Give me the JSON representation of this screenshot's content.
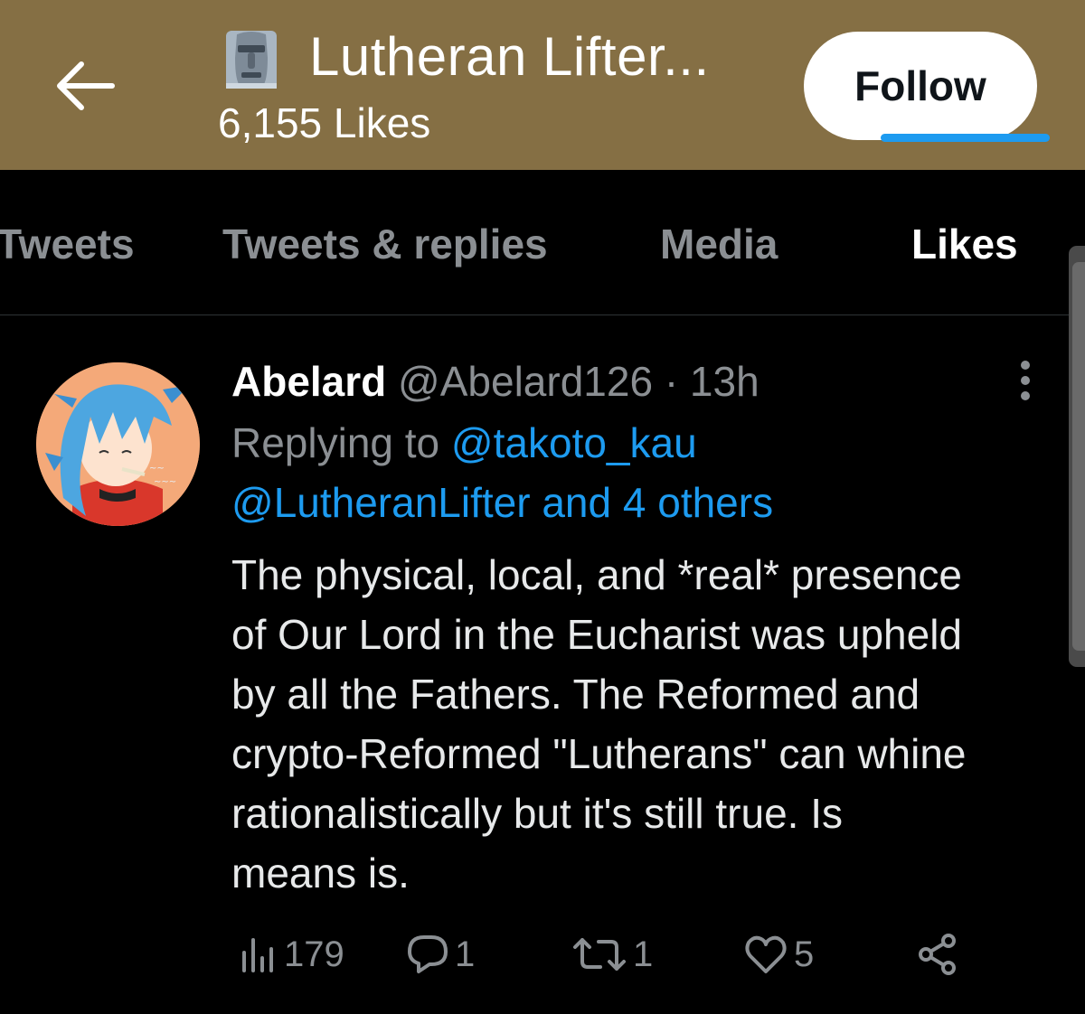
{
  "header": {
    "title": "Lutheran Lifter...",
    "likes_label": "6,155 Likes",
    "follow_label": "Follow",
    "title_emoji": "moai-icon",
    "background_color": "#856f44"
  },
  "tabs": [
    {
      "label": "Tweets",
      "active": false
    },
    {
      "label": "Tweets & replies",
      "active": false
    },
    {
      "label": "Media",
      "active": false
    },
    {
      "label": "Likes",
      "active": true
    }
  ],
  "accent_color": "#1d9bf0",
  "tweet": {
    "display_name": "Abelard",
    "meta": "@Abelard126 · 13h",
    "replying_prefix": "Replying to",
    "replying_mention_1": "@takoto_kau",
    "replying_line_2": "@LutheranLifter and 4 others",
    "text_lines": [
      "The physical, local, and *real* presence",
      "of Our Lord in the Eucharist was upheld",
      "by all the Fathers. The Reformed and",
      "crypto-Reformed \"Lutherans\" can whine",
      "rationalistically but it's still true. Is",
      "means is."
    ],
    "stats": {
      "views": "179",
      "replies": "1",
      "retweets": "1",
      "likes": "5"
    }
  }
}
